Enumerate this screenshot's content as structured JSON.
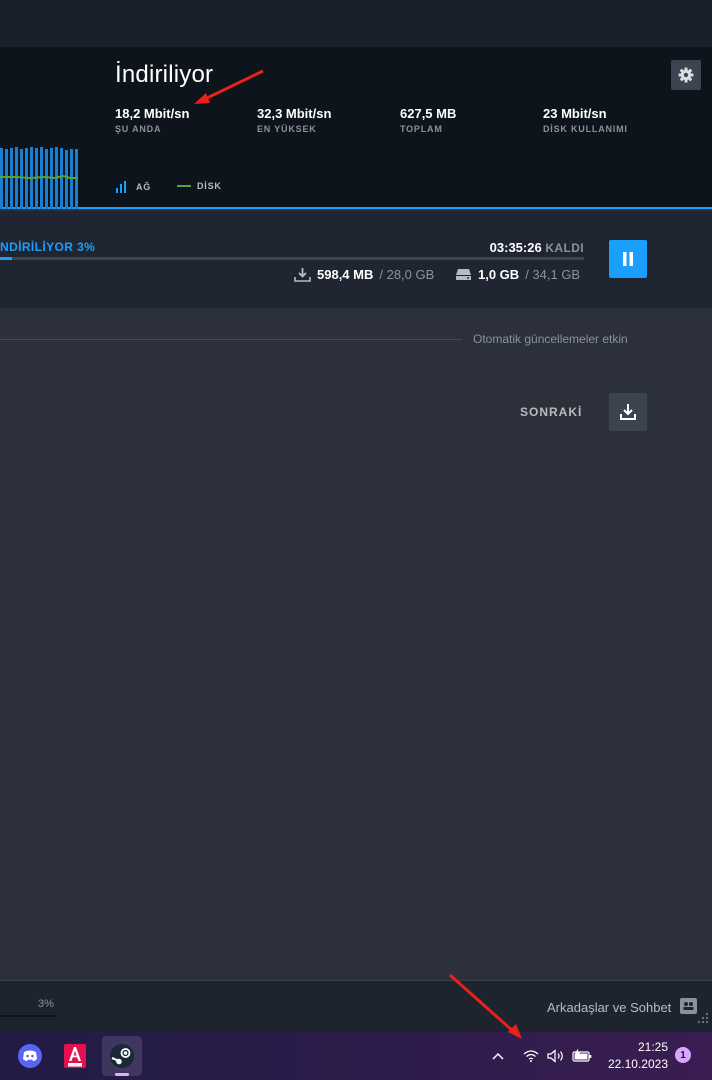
{
  "stats": {
    "title": "İndiriliyor",
    "current": {
      "value": "18,2 Mbit/sn",
      "label": "ŞU ANDA"
    },
    "peak": {
      "value": "32,3 Mbit/sn",
      "label": "EN YÜKSEK"
    },
    "total": {
      "value": "627,5 MB",
      "label": "TOPLAM"
    },
    "disk": {
      "value": "23 Mbit/sn",
      "label": "DİSK KULLANIMI"
    },
    "legend_network": "AĞ",
    "legend_disk": "DİSK"
  },
  "download": {
    "status": "NDİRİLİYOR 3%",
    "time_value": "03:35:26",
    "time_suffix": "KALDI",
    "progress_fraction": 0.02,
    "downloaded": "598,4 MB",
    "download_total": "/ 28,0 GB",
    "disk_done": "1,0 GB",
    "disk_total": "/ 34,1 GB"
  },
  "auto_updates": "Otomatik güncellemeler etkin",
  "next_label": "SONRAKİ",
  "bottom": {
    "percent": "3%",
    "friends": "Arkadaşlar ve Sohbet"
  },
  "taskbar": {
    "apps": [
      "discord-icon",
      "autocad-icon",
      "steam-icon"
    ],
    "time": "21:25",
    "date": "22.10.2023",
    "notifications": "1"
  },
  "colors": {
    "accent": "#1a9fff",
    "disk_line": "#5ba32b",
    "background": "#2b303a",
    "panel": "#0e141b"
  }
}
